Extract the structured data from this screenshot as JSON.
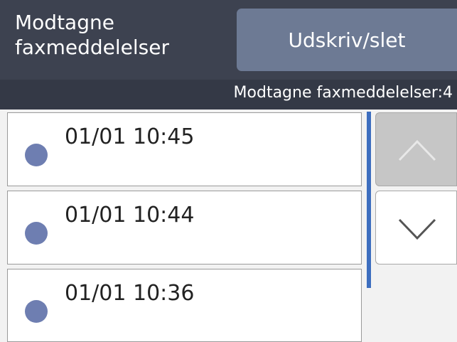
{
  "header": {
    "title_line1": "Modtagne",
    "title_line2": "faxmeddelelser",
    "action_button": "Udskriv/slet"
  },
  "status": {
    "count_text": "Modtagne faxmeddelelser:4"
  },
  "list": {
    "items": [
      {
        "time": "01/01 10:45"
      },
      {
        "time": "01/01 10:44"
      },
      {
        "time": "01/01 10:36"
      }
    ]
  },
  "icons": {
    "scroll_up": "chevron-up-icon",
    "scroll_down": "chevron-down-icon",
    "item_marker": "dot-icon"
  },
  "colors": {
    "header": "#3d4250",
    "button": "#6d7a94",
    "dot": "#6e7eb1",
    "scrollbar": "#3d6ebf"
  }
}
